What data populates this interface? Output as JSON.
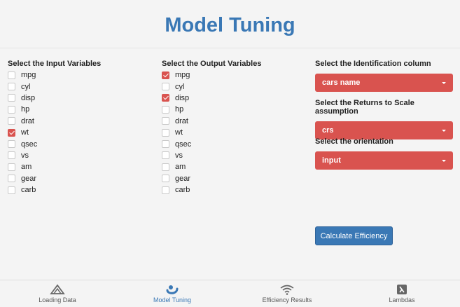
{
  "page_title": "Model Tuning",
  "input_section": {
    "label": "Select the Input Variables",
    "items": [
      {
        "name": "mpg",
        "checked": false
      },
      {
        "name": "cyl",
        "checked": false
      },
      {
        "name": "disp",
        "checked": false
      },
      {
        "name": "hp",
        "checked": false
      },
      {
        "name": "drat",
        "checked": false
      },
      {
        "name": "wt",
        "checked": true
      },
      {
        "name": "qsec",
        "checked": false
      },
      {
        "name": "vs",
        "checked": false
      },
      {
        "name": "am",
        "checked": false
      },
      {
        "name": "gear",
        "checked": false
      },
      {
        "name": "carb",
        "checked": false
      }
    ]
  },
  "output_section": {
    "label": "Select the Output Variables",
    "items": [
      {
        "name": "mpg",
        "checked": true
      },
      {
        "name": "cyl",
        "checked": false
      },
      {
        "name": "disp",
        "checked": true
      },
      {
        "name": "hp",
        "checked": false
      },
      {
        "name": "drat",
        "checked": false
      },
      {
        "name": "wt",
        "checked": false
      },
      {
        "name": "qsec",
        "checked": false
      },
      {
        "name": "vs",
        "checked": false
      },
      {
        "name": "am",
        "checked": false
      },
      {
        "name": "gear",
        "checked": false
      },
      {
        "name": "carb",
        "checked": false
      }
    ]
  },
  "identification": {
    "label": "Select the Identification column",
    "value": "cars name"
  },
  "returns_to_scale": {
    "label": "Select the Returns to Scale assumption",
    "value": "crs"
  },
  "orientation": {
    "label": "Select the orientation",
    "value": "input"
  },
  "calculate_button": "Calculate Efficiency",
  "tabs": [
    {
      "label": "Loading Data",
      "icon": "ramp-icon",
      "active": false
    },
    {
      "label": "Model Tuning",
      "icon": "tuning-icon",
      "active": true
    },
    {
      "label": "Efficiency Results",
      "icon": "signal-icon",
      "active": false
    },
    {
      "label": "Lambdas",
      "icon": "lambda-icon",
      "active": false
    }
  ],
  "colors": {
    "accent": "#3a78b5",
    "danger": "#d9534f"
  }
}
